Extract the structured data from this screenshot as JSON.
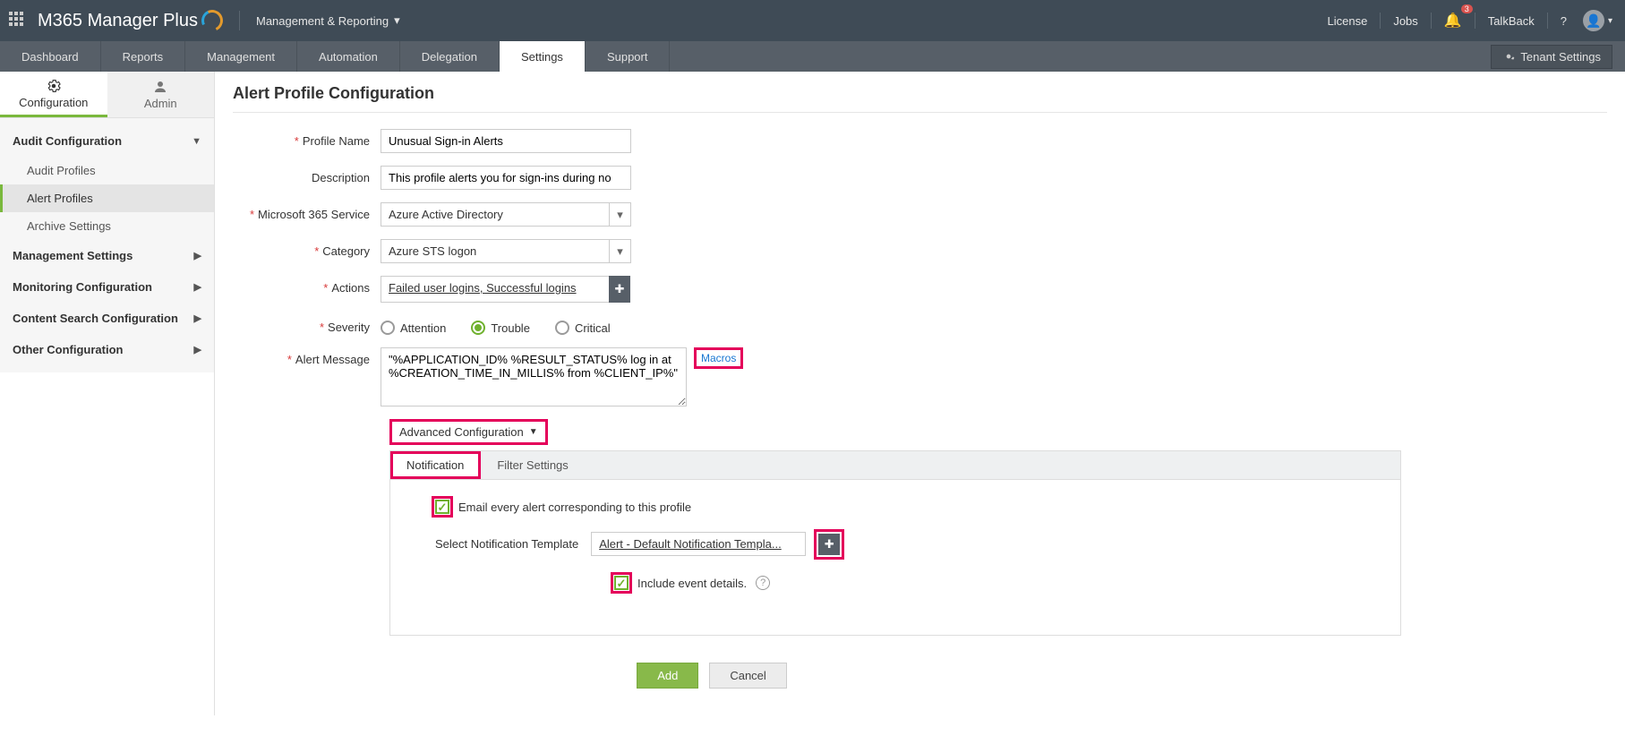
{
  "topbar": {
    "brand": "M365 Manager Plus",
    "module": "Management & Reporting",
    "license": "License",
    "jobs": "Jobs",
    "notif_count": "3",
    "talkback": "TalkBack"
  },
  "navtabs": [
    "Dashboard",
    "Reports",
    "Management",
    "Automation",
    "Delegation",
    "Settings",
    "Support"
  ],
  "navtabs_active": "Settings",
  "tenant_settings": "Tenant Settings",
  "subtabs": {
    "configuration": "Configuration",
    "admin": "Admin"
  },
  "side": {
    "group1": "Audit Configuration",
    "g1_items": [
      "Audit Profiles",
      "Alert Profiles",
      "Archive Settings"
    ],
    "g1_active": "Alert Profiles",
    "group2": "Management Settings",
    "group3": "Monitoring Configuration",
    "group4": "Content Search Configuration",
    "group5": "Other Configuration"
  },
  "page_title": "Alert Profile Configuration",
  "form": {
    "profile_name_label": "Profile Name",
    "profile_name_value": "Unusual Sign-in Alerts",
    "description_label": "Description",
    "description_value": "This profile alerts you for sign-ins during no",
    "service_label": "Microsoft 365 Service",
    "service_value": "Azure Active Directory",
    "category_label": "Category",
    "category_value": "Azure STS logon",
    "actions_label": "Actions",
    "actions_value": "Failed user logins, Successful logins",
    "severity_label": "Severity",
    "severity_options": [
      "Attention",
      "Trouble",
      "Critical"
    ],
    "severity_selected": "Trouble",
    "alert_msg_label": "Alert Message",
    "alert_msg_value": "\"%APPLICATION_ID% %RESULT_STATUS% log in at %CREATION_TIME_IN_MILLIS% from %CLIENT_IP%\"",
    "macros": "Macros"
  },
  "adv": {
    "toggle": "Advanced Configuration",
    "tabs": [
      "Notification",
      "Filter Settings"
    ],
    "tabs_active": "Notification",
    "email_every": "Email every alert corresponding to this profile",
    "tmpl_label": "Select Notification Template",
    "tmpl_value": "Alert - Default Notification Templa...",
    "include_event": "Include event details."
  },
  "buttons": {
    "add": "Add",
    "cancel": "Cancel"
  }
}
